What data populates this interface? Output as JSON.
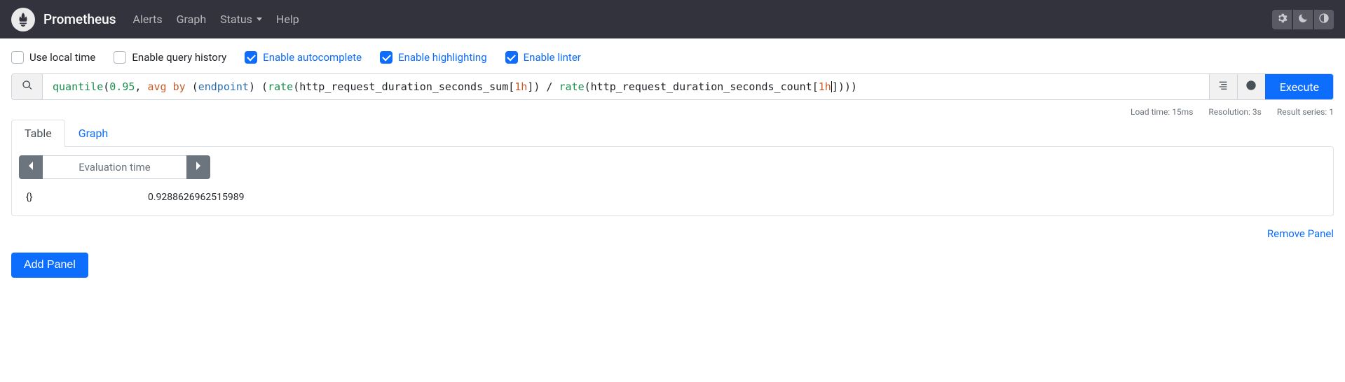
{
  "brand": "Prometheus",
  "nav": {
    "alerts": "Alerts",
    "graph": "Graph",
    "status": "Status",
    "help": "Help"
  },
  "options": {
    "use_local_time": {
      "label": "Use local time",
      "checked": false
    },
    "enable_history": {
      "label": "Enable query history",
      "checked": false
    },
    "enable_autocomp": {
      "label": "Enable autocomplete",
      "checked": true
    },
    "enable_highlight": {
      "label": "Enable highlighting",
      "checked": true
    },
    "enable_linter": {
      "label": "Enable linter",
      "checked": true
    }
  },
  "query": {
    "tokens": {
      "fn_quantile": "quantile",
      "open1": "(",
      "num_q": "0.95",
      "comma": ", ",
      "kw_avg": "avg",
      "sp1": " ",
      "kw_by": "by",
      "sp2": " ",
      "open2": "(",
      "lbl_endpoint": "endpoint",
      "close2": ")",
      "sp3": " ",
      "open3": "(",
      "fn_rate1": "rate",
      "open4": "(",
      "metric1": "http_request_duration_seconds_sum",
      "lb1": "[",
      "dur1": "1h",
      "rb1": "]",
      "close4": ")",
      "sp4": " ",
      "div": "/",
      "sp5": " ",
      "fn_rate2": "rate",
      "open5": "(",
      "metric2": "http_request_duration_seconds_count",
      "lb2": "[",
      "dur2": "1h",
      "rb2": "]",
      "close5": ")",
      "close3": ")",
      "close1": ")"
    },
    "execute_label": "Execute"
  },
  "stats": {
    "load_time": "Load time: 15ms",
    "resolution": "Resolution: 3s",
    "result_series": "Result series: 1"
  },
  "tabs": {
    "table": "Table",
    "graph": "Graph"
  },
  "eval_time_placeholder": "Evaluation time",
  "result": {
    "labels": "{}",
    "value": "0.9288626962515989"
  },
  "remove_panel": "Remove Panel",
  "add_panel": "Add Panel"
}
